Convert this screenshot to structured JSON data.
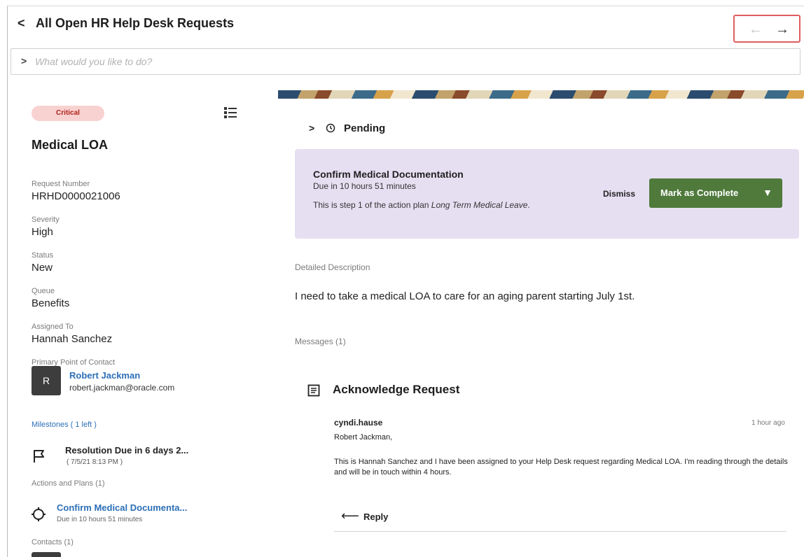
{
  "header": {
    "back_icon": "chevron-left-icon",
    "back_glyph": "<",
    "title": "All Open HR Help Desk Requests",
    "prev_glyph": "←",
    "next_glyph": "→"
  },
  "search": {
    "chevron": ">",
    "placeholder": "What would you like to do?"
  },
  "request": {
    "severity_badge": "Critical",
    "title": "Medical LOA",
    "fields": [
      {
        "label": "Request Number",
        "value": "HRHD0000021006"
      },
      {
        "label": "Severity",
        "value": "High"
      },
      {
        "label": "Status",
        "value": "New"
      },
      {
        "label": "Queue",
        "value": "Benefits"
      },
      {
        "label": "Assigned To",
        "value": "Hannah Sanchez"
      }
    ],
    "primary_contact_label": "Primary Point of Contact",
    "primary_contact": {
      "initial": "R",
      "name": "Robert Jackman",
      "email": "robert.jackman@oracle.com"
    },
    "milestones_link": "Milestones ( 1 left )",
    "milestone": {
      "title": "Resolution Due in 6 days 2...",
      "date": "( 7/5/21 8:13 PM )"
    },
    "actions_label": "Actions and Plans (1)",
    "action": {
      "title": "Confirm Medical Documenta...",
      "due": "Due in 10 hours 51 minutes"
    },
    "contacts_label": "Contacts (1)"
  },
  "detail": {
    "pending_chevron": ">",
    "pending_label": "Pending",
    "task": {
      "title": "Confirm Medical Documentation",
      "due": "Due in 10 hours 51 minutes",
      "step_prefix": "This is step 1 of the action plan ",
      "step_plan": "Long Term Medical Leave",
      "step_suffix": ".",
      "dismiss_label": "Dismiss",
      "complete_label": "Mark as Complete",
      "complete_caret": "▼"
    },
    "description_label": "Detailed Description",
    "description": "I need to take a medical LOA to care for an aging parent starting July 1st.",
    "messages_label": "Messages (1)",
    "message": {
      "title": "Acknowledge Request",
      "author": "cyndi.hause",
      "time": "1 hour ago",
      "greeting": "Robert Jackman,",
      "body": "This is Hannah Sanchez and I have been assigned to your Help Desk request regarding Medical LOA. I'm reading through the details and will be in touch within 4 hours.",
      "reply_glyph": "⟵",
      "reply_label": "Reply"
    }
  },
  "colors": {
    "critical_bg": "#f8d2d0",
    "critical_text": "#b2221b",
    "link": "#2c6fb7",
    "task_card_bg": "#e6dff2",
    "primary_button": "#4f7a3c",
    "highlight_box": "#e05d5d"
  }
}
